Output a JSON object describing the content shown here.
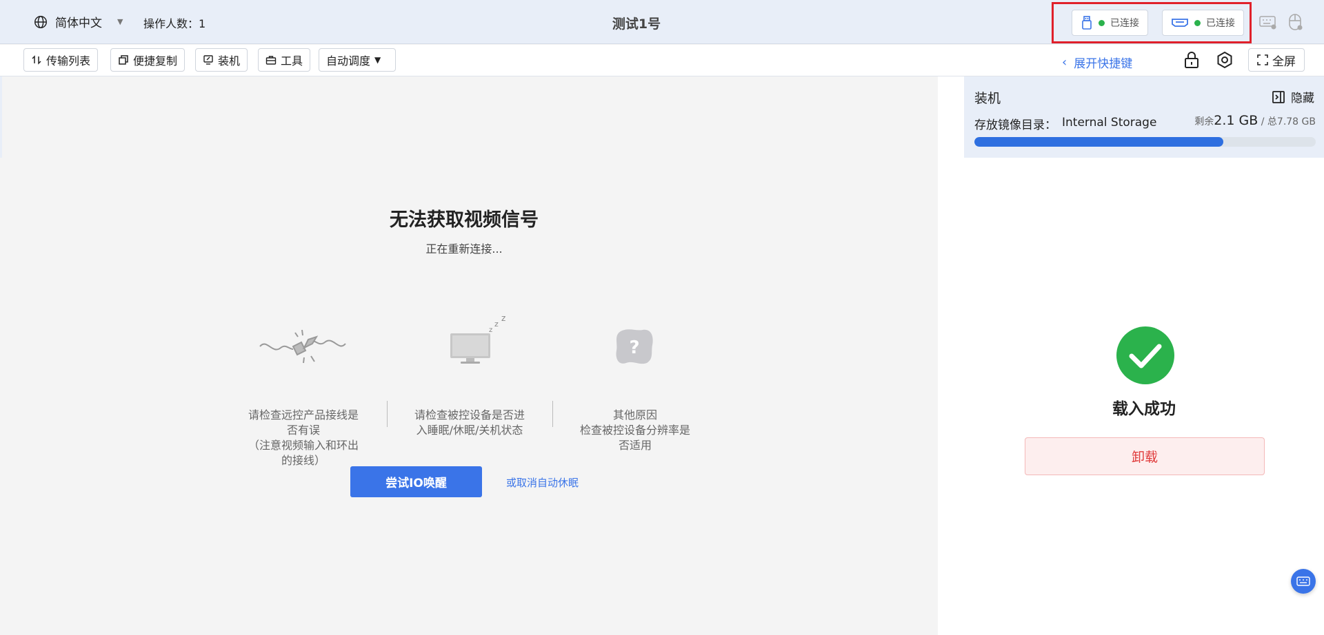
{
  "topbar": {
    "language_label": "简体中文",
    "operators_label": "操作人数：1",
    "title": "测试1号",
    "usb_status": "已连接",
    "hdmi_status": "已连接"
  },
  "toolbar": {
    "transfer_label": "传输列表",
    "copy_label": "便捷复制",
    "install_label": "装机",
    "tools_label": "工具",
    "auto_label": "自动调度",
    "expand_label": "展开快捷键",
    "fullscreen_label": "全屏"
  },
  "main": {
    "no_signal": "无法获取视频信号",
    "reconnect": "正在重新连接...",
    "reasons": [
      {
        "line1": "请检查远控产品接线是",
        "line2": "否有误",
        "line3": "（注意视频输入和环出",
        "line4": "的接线）"
      },
      {
        "line1": "请检查被控设备是否进",
        "line2": "入睡眠/休眠/关机状态"
      },
      {
        "line1": "其他原因",
        "line2": "检查被控设备分辨率是",
        "line3": "否适用"
      }
    ],
    "wake_button": "尝试IO唤醒",
    "cancel_sleep": "或取消自动休眠"
  },
  "panel": {
    "title": "装机",
    "hide_label": "隐藏",
    "store_label": "存放镜像目录：",
    "store_value": "Internal Storage",
    "remain_prefix": "剩余",
    "remain_value": "2.1 GB",
    "total_label": " / 总7.78 GB",
    "usage_fraction": 0.73,
    "success_text": "载入成功",
    "unload_button": "卸载"
  },
  "colors": {
    "accent": "#3a74e8",
    "success": "#2bb24c",
    "danger": "#e03a3a",
    "highlight_box": "#e0202a"
  }
}
